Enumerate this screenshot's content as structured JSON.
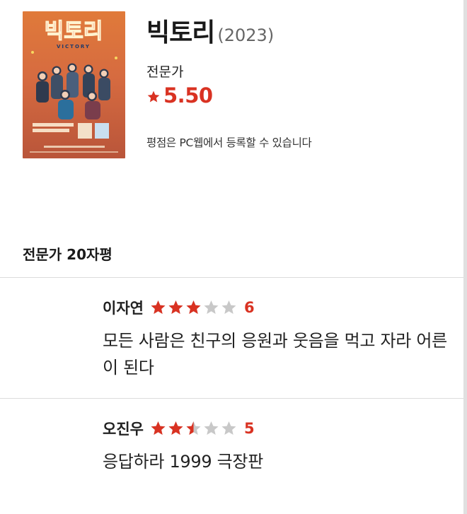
{
  "movie": {
    "title": "빅토리",
    "year": "(2023)",
    "critic_label": "전문가",
    "rating": "5.50",
    "notice": "평점은 PC웹에서 등록할 수 있습니다",
    "poster": {
      "title_text": "빅토리",
      "subtitle_text": "VICTORY"
    }
  },
  "reviews_section": {
    "title": "전문가 20자평"
  },
  "reviews": [
    {
      "name": "이자연",
      "stars": 3,
      "score": "6",
      "text": "모든 사람은 친구의 응원과 웃음을 먹고 자라 어른이 된다"
    },
    {
      "name": "오진우",
      "stars": 2.5,
      "score": "5",
      "text": "응답하라 1999 극장판"
    }
  ],
  "colors": {
    "accent": "#d93222",
    "star_empty": "#c8c8c8",
    "divider": "#dcdcdc"
  },
  "icons": {
    "rating": "star-icon",
    "review_star": "star-icon"
  }
}
